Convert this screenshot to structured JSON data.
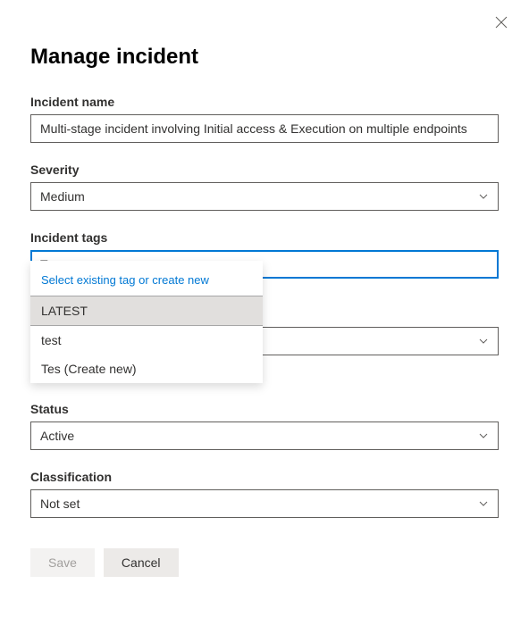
{
  "title": "Manage incident",
  "fields": {
    "incidentName": {
      "label": "Incident name",
      "value": "Multi-stage incident involving Initial access & Execution on multiple endpoints"
    },
    "severity": {
      "label": "Severity",
      "value": "Medium"
    },
    "incidentTags": {
      "label": "Incident tags",
      "value": "Tes"
    },
    "status": {
      "label": "Status",
      "value": "Active"
    },
    "classification": {
      "label": "Classification",
      "value": "Not set"
    }
  },
  "tagDropdown": {
    "header": "Select existing tag or create new",
    "items": [
      {
        "label": "LATEST",
        "selected": true
      },
      {
        "label": "test",
        "selected": false
      },
      {
        "label": "Tes (Create new)",
        "selected": false
      }
    ]
  },
  "buttons": {
    "save": "Save",
    "cancel": "Cancel"
  }
}
